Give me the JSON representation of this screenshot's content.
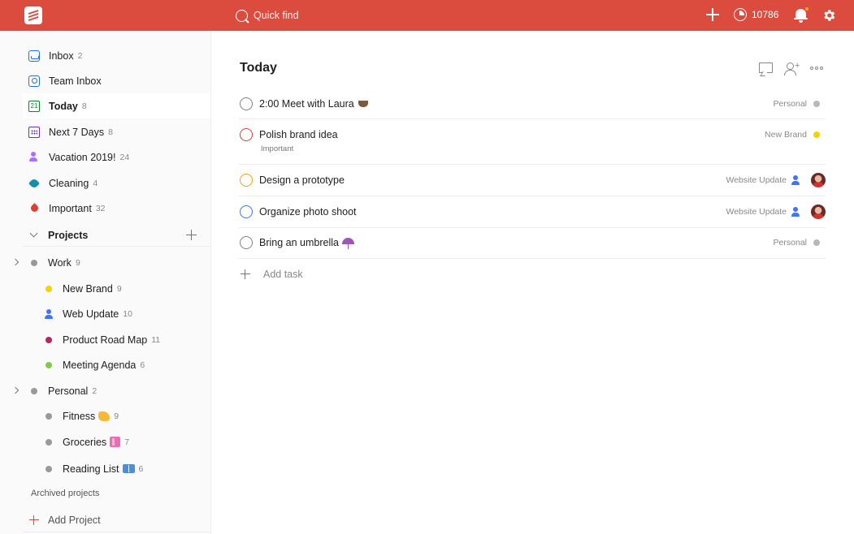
{
  "topbar": {
    "search_placeholder": "Quick find",
    "karma": "10786"
  },
  "sidebar": {
    "nav": [
      {
        "label": "Inbox",
        "count": "2"
      },
      {
        "label": "Team Inbox",
        "count": ""
      },
      {
        "label": "Today",
        "count": "8",
        "icon_text": "21"
      },
      {
        "label": "Next 7 Days",
        "count": "8"
      },
      {
        "label": "Vacation 2019!",
        "count": "24"
      },
      {
        "label": "Cleaning",
        "count": "4"
      },
      {
        "label": "Important",
        "count": "32"
      }
    ],
    "projects_label": "Projects",
    "projects": [
      {
        "label": "Work",
        "count": "9",
        "color": "#999999"
      },
      {
        "label": "New Brand",
        "count": "9",
        "color": "#fad000"
      },
      {
        "label": "Web Update",
        "count": "10",
        "color": "#4073ff"
      },
      {
        "label": "Product Road Map",
        "count": "11",
        "color": "#b8255f"
      },
      {
        "label": "Meeting Agenda",
        "count": "6",
        "color": "#7ecc49"
      },
      {
        "label": "Personal",
        "count": "2",
        "color": "#999999"
      },
      {
        "label": "Fitness",
        "count": "9",
        "color": "#999999"
      },
      {
        "label": "Groceries",
        "count": "7",
        "color": "#999999"
      },
      {
        "label": "Reading List",
        "count": "6",
        "color": "#999999"
      }
    ],
    "archived_label": "Archived projects",
    "add_project_label": "Add Project"
  },
  "main": {
    "title": "Today",
    "share_plus": "+",
    "tasks": [
      {
        "content": "2:00 Meet with Laura",
        "project": "Personal",
        "project_color": "#b8b8b8",
        "check_color": "#808080"
      },
      {
        "content": "Polish brand idea",
        "sub": "Important",
        "project": "New Brand",
        "project_color": "#fad000",
        "check_color": "#db4035"
      },
      {
        "content": "Design a prototype",
        "project": "Website Update",
        "project_color": "#4073ff",
        "check_color": "#ff9a14"
      },
      {
        "content": "Organize photo shoot",
        "project": "Website Update",
        "project_color": "#4073ff",
        "check_color": "#4073ff"
      },
      {
        "content": "Bring an umbrella",
        "project": "Personal",
        "project_color": "#b8b8b8",
        "check_color": "#808080"
      }
    ],
    "add_task_label": "Add task"
  },
  "colors": {
    "brand": "#db4c3f",
    "sidebar_bg": "#fafafa"
  }
}
